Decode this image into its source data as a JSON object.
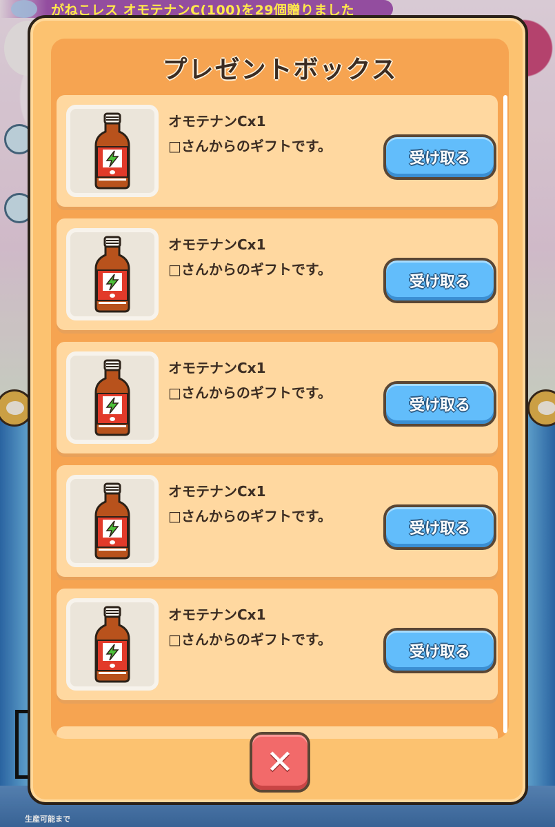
{
  "notification": {
    "text": "がねこレス オモテナンC(100)を29個贈りました"
  },
  "background": {
    "bottom_text": "生産可能まで"
  },
  "dialog": {
    "title": "プレゼントボックス",
    "items": [
      {
        "name": "オモテナンCx1",
        "description": "□さんからのギフトです。",
        "button_label": "受け取る",
        "icon": "energy-drink-bottle-icon"
      },
      {
        "name": "オモテナンCx1",
        "description": "□さんからのギフトです。",
        "button_label": "受け取る",
        "icon": "energy-drink-bottle-icon"
      },
      {
        "name": "オモテナンCx1",
        "description": "□さんからのギフトです。",
        "button_label": "受け取る",
        "icon": "energy-drink-bottle-icon"
      },
      {
        "name": "オモテナンCx1",
        "description": "□さんからのギフトです。",
        "button_label": "受け取る",
        "icon": "energy-drink-bottle-icon"
      },
      {
        "name": "オモテナンCx1",
        "description": "□さんからのギフトです。",
        "button_label": "受け取る",
        "icon": "energy-drink-bottle-icon"
      }
    ],
    "close_icon": "close-x-icon"
  },
  "colors": {
    "dialog_bg": "#fcc270",
    "panel_bg": "#f6a451",
    "item_bg": "#ffd8a0",
    "receive_button": "#62bdfb",
    "close_button": "#f26a6a",
    "notification_text": "#ffe94a"
  }
}
